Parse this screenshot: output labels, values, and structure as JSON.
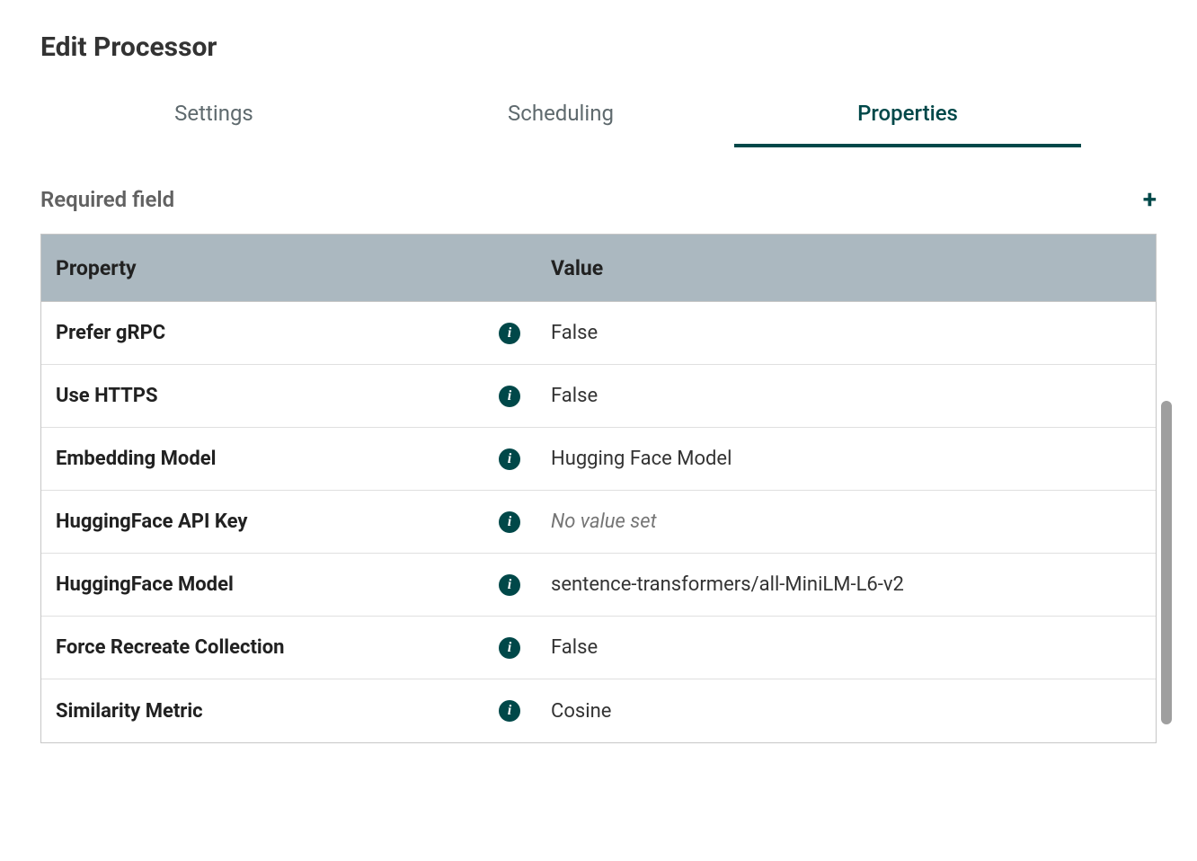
{
  "title": "Edit Processor",
  "tabs": [
    {
      "label": "Settings",
      "active": false
    },
    {
      "label": "Scheduling",
      "active": false
    },
    {
      "label": "Properties",
      "active": true
    }
  ],
  "section_label": "Required field",
  "table": {
    "headers": {
      "property": "Property",
      "value": "Value"
    },
    "rows": [
      {
        "name": "Prefer gRPC",
        "value": "False",
        "empty": false
      },
      {
        "name": "Use HTTPS",
        "value": "False",
        "empty": false
      },
      {
        "name": "Embedding Model",
        "value": "Hugging Face Model",
        "empty": false
      },
      {
        "name": "HuggingFace API Key",
        "value": "No value set",
        "empty": true
      },
      {
        "name": "HuggingFace Model",
        "value": "sentence-transformers/all-MiniLM-L6-v2",
        "empty": false
      },
      {
        "name": "Force Recreate Collection",
        "value": "False",
        "empty": false
      },
      {
        "name": "Similarity Metric",
        "value": "Cosine",
        "empty": false
      }
    ]
  },
  "icons": {
    "info_glyph": "i",
    "plus_glyph": "+"
  }
}
